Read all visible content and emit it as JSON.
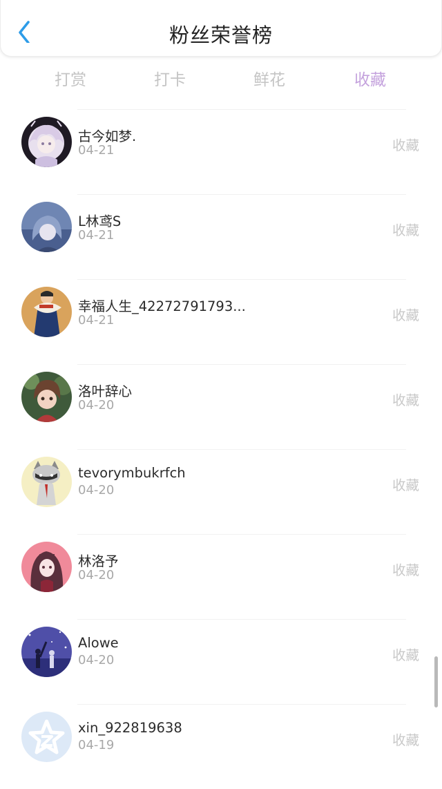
{
  "header": {
    "title": "粉丝荣誉榜",
    "back_icon": "chevron-left-icon",
    "accent_color": "#2d9ce8"
  },
  "tabs": [
    {
      "label": "打赏",
      "active": false
    },
    {
      "label": "打卡",
      "active": false
    },
    {
      "label": "鲜花",
      "active": false
    },
    {
      "label": "收藏",
      "active": true
    }
  ],
  "colors": {
    "active_tab": "#c4a2dd",
    "inactive_tab": "#c4c4c4",
    "date": "#a8a8a8",
    "action": "#c8c8c8"
  },
  "fans": [
    {
      "name": "古今如梦.",
      "date": "04-21",
      "action": "收藏",
      "avatar": "anime-girl-white-hair"
    },
    {
      "name": "L林鸢S",
      "date": "04-21",
      "action": "收藏",
      "avatar": "anime-girl-blue"
    },
    {
      "name": "幸福人生_42272791793...",
      "date": "04-21",
      "action": "收藏",
      "avatar": "person-with-fan"
    },
    {
      "name": "洛叶辞心",
      "date": "04-20",
      "action": "收藏",
      "avatar": "doll-girl-green"
    },
    {
      "name": "tevorymbukrfch",
      "date": "04-20",
      "action": "收藏",
      "avatar": "cartoon-raccoon"
    },
    {
      "name": "林洛予",
      "date": "04-20",
      "action": "收藏",
      "avatar": "anime-girl-pink"
    },
    {
      "name": "Alowe",
      "date": "04-20",
      "action": "收藏",
      "avatar": "couple-night-sky"
    },
    {
      "name": "xin_922819638",
      "date": "04-19",
      "action": "收藏",
      "avatar": "default-star-logo"
    }
  ]
}
